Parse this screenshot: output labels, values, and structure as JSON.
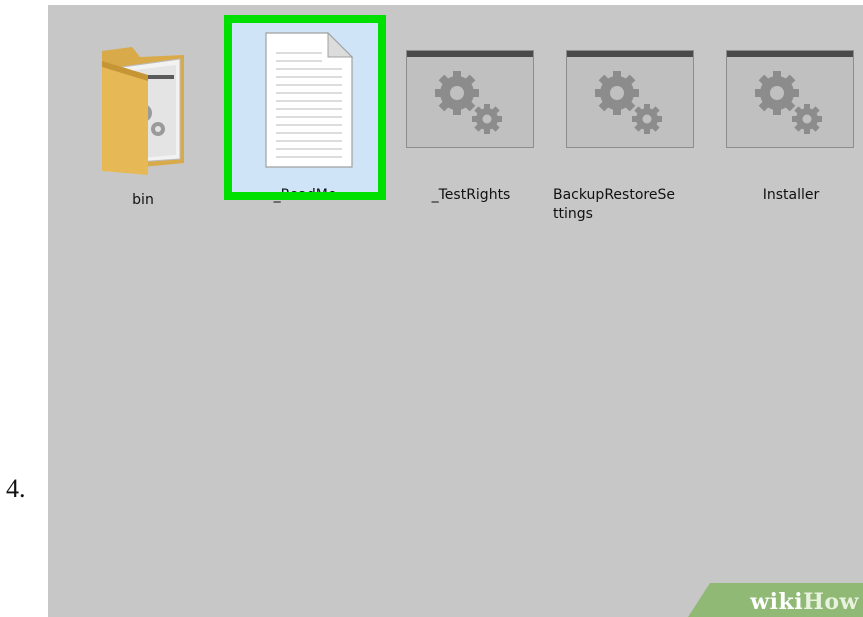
{
  "step": {
    "number": "4."
  },
  "files": [
    {
      "name": "bin",
      "icon": "folder-icon"
    },
    {
      "name": "_ReadMe",
      "icon": "text-document-icon",
      "selected": true
    },
    {
      "name": "_TestRights",
      "icon": "settings-window-icon"
    },
    {
      "name": "BackupRestoreSettings",
      "label_line1": "BackupRestoreSe",
      "label_line2": "ttings",
      "icon": "settings-window-icon"
    },
    {
      "name": "Installer",
      "icon": "settings-window-icon"
    }
  ],
  "watermark": {
    "part1": "wiki",
    "part2": "How"
  },
  "colors": {
    "background": "#c7c7c7",
    "highlight": "#00e000",
    "selection": "#cfe4f7",
    "watermark": "#8fb974"
  }
}
